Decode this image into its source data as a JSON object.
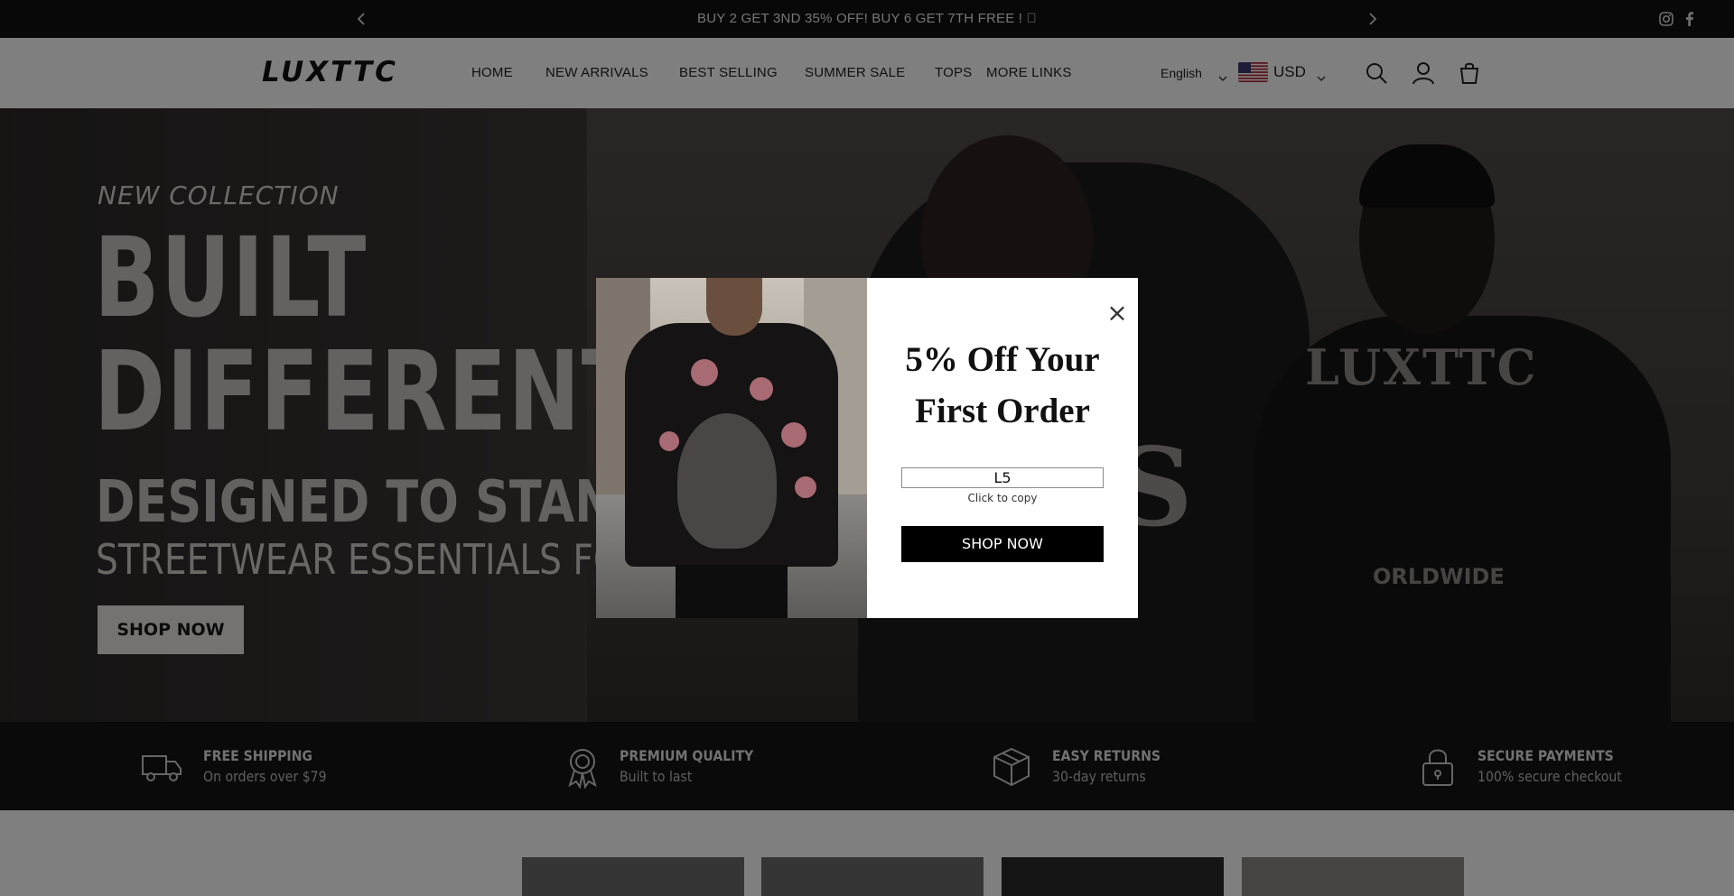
{
  "announcement": {
    "message": "BUY 2 GET 3ND 35% OFF! BUY 6 GET 7TH FREE ! \u0000",
    "prev_icon": "chevron-left-icon",
    "next_icon": "chevron-right-icon",
    "social": [
      "instagram-icon",
      "facebook-icon"
    ]
  },
  "header": {
    "logo": "LUXTTC",
    "nav": [
      "HOME",
      "NEW ARRIVALS",
      "BEST SELLING",
      "SUMMER SALE",
      "TOPS",
      "MORE LINKS"
    ],
    "language": "English",
    "currency": "USD",
    "icons": [
      "search-icon",
      "account-icon",
      "cart-icon"
    ]
  },
  "hero": {
    "kicker": "NEW COLLECTION",
    "title_line1": "BUILT",
    "title_line2": "DIFFERENT",
    "subtitle1": "DESIGNED TO STAND",
    "subtitle2": "STREETWEAR ESSENTIALS FO",
    "cta": "SHOP NOW",
    "shirt_print": "LUXTTC",
    "shirt_print2": "ORLDWIDE"
  },
  "features": [
    {
      "icon": "truck-icon",
      "title": "FREE SHIPPING",
      "subtitle": "On orders over $79"
    },
    {
      "icon": "award-badge-icon",
      "title": "PREMIUM QUALITY",
      "subtitle": "Built to last"
    },
    {
      "icon": "box-icon",
      "title": "EASY RETURNS",
      "subtitle": "30-day returns"
    },
    {
      "icon": "lock-icon",
      "title": "SECURE PAYMENTS",
      "subtitle": "100% secure checkout"
    }
  ],
  "popup": {
    "heading_line1": "5% Off Your",
    "heading_line2": "First Order",
    "code": "L5",
    "copy_hint": "Click to copy",
    "cta": "SHOP NOW",
    "close": "×"
  },
  "colors": {
    "announcement_bg": "#111111",
    "features_bg": "#151515",
    "popup_button": "#000000"
  }
}
